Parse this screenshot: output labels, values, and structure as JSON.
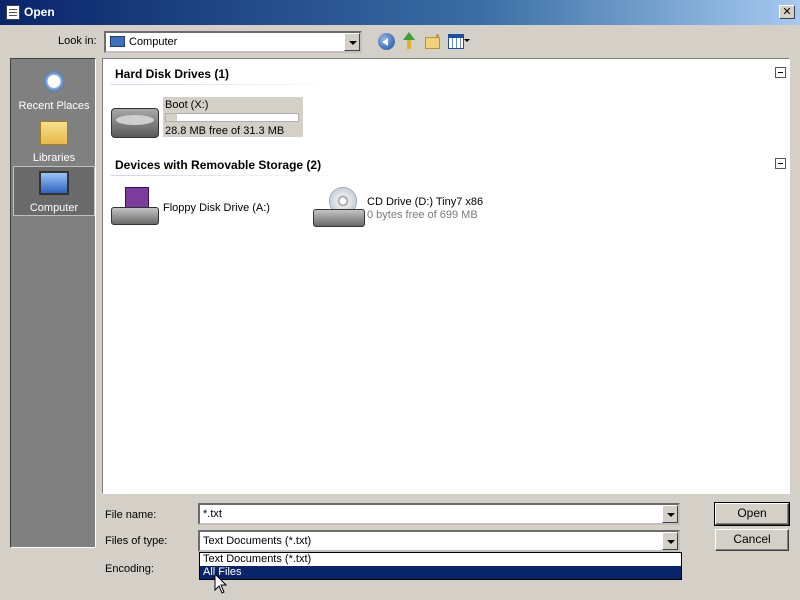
{
  "window": {
    "title": "Open"
  },
  "lookin": {
    "label": "Look in:",
    "value": "Computer"
  },
  "places": [
    {
      "label": "Recent Places",
      "icon": "recent-places-icon"
    },
    {
      "label": "Libraries",
      "icon": "libraries-icon"
    },
    {
      "label": "Computer",
      "icon": "computer-icon",
      "selected": true
    }
  ],
  "groups": {
    "hdd": {
      "title": "Hard Disk Drives (1)"
    },
    "removable": {
      "title": "Devices with Removable Storage (2)"
    }
  },
  "drives": {
    "boot": {
      "name": "Boot (X:)",
      "free": "28.8 MB free of 31.3 MB",
      "used_fraction": 0.08
    },
    "floppy": {
      "name": "Floppy Disk Drive (A:)"
    },
    "cd": {
      "name": "CD Drive (D:) Tiny7 x86",
      "free": "0 bytes free of 699 MB"
    }
  },
  "form": {
    "filename_label": "File name:",
    "filename_value": "*.txt",
    "filetype_label": "Files of type:",
    "filetype_value": "Text Documents (*.txt)",
    "encoding_label": "Encoding:",
    "filetype_options": [
      "Text Documents (*.txt)",
      "All Files"
    ],
    "open_label": "Open",
    "cancel_label": "Cancel"
  },
  "colors": {
    "titlebar": "#0a246a",
    "selection": "#0a246a",
    "places_bg": "#808080"
  }
}
